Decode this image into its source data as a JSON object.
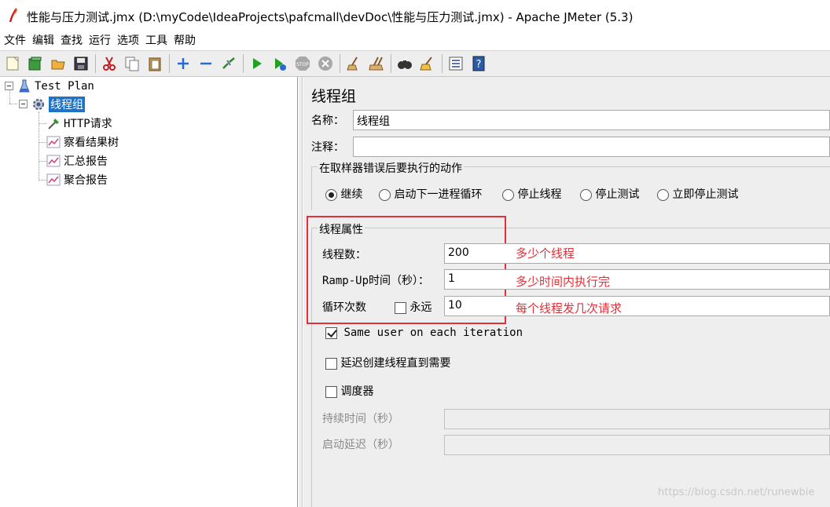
{
  "window": {
    "title": "性能与压力测试.jmx (D:\\myCode\\IdeaProjects\\pafcmall\\devDoc\\性能与压力测试.jmx) - Apache JMeter (5.3)"
  },
  "menu": [
    "文件",
    "编辑",
    "查找",
    "运行",
    "选项",
    "工具",
    "帮助"
  ],
  "toolbar": {
    "icons": [
      "new-icon",
      "templates-icon",
      "open-icon",
      "save-icon",
      "cut-icon",
      "copy-icon",
      "paste-icon",
      "expand-icon",
      "collapse-icon",
      "toggle-icon",
      "start-icon",
      "start-no-pause-icon",
      "stop-icon",
      "shutdown-icon",
      "clear-icon",
      "clear-all-icon",
      "search-icon",
      "reset-search-icon",
      "function-helper-icon",
      "help-icon"
    ]
  },
  "tree": {
    "root": "Test Plan",
    "thread_group": "线程组",
    "children": [
      "HTTP请求",
      "察看结果树",
      "汇总报告",
      "聚合报告"
    ]
  },
  "panel": {
    "heading": "线程组",
    "name_label": "名称：",
    "name_value": "线程组",
    "comment_label": "注释：",
    "comment_value": "",
    "error_action_title": "在取样器错误后要执行的动作",
    "error_actions": [
      "继续",
      "启动下一进程循环",
      "停止线程",
      "停止测试",
      "立即停止测试"
    ],
    "error_action_selected": "继续",
    "thread_props_title": "线程属性",
    "threads_label": "线程数：",
    "threads_value": "200",
    "rampup_label": "Ramp-Up时间（秒）：",
    "rampup_value": "1",
    "loop_label": "循环次数",
    "forever_label": "永远",
    "forever_checked": false,
    "loop_value": "10",
    "same_user_label": "Same user on each iteration",
    "same_user_checked": true,
    "delay_create_label": "延迟创建线程直到需要",
    "delay_create_checked": false,
    "scheduler_label": "调度器",
    "scheduler_checked": false,
    "duration_label": "持续时间（秒）",
    "duration_value": "",
    "startup_delay_label": "启动延迟（秒）",
    "startup_delay_value": ""
  },
  "annotations": {
    "threads_note": "多少个线程",
    "rampup_note": "多少时间内执行完",
    "loop_note": "每个线程发几次请求"
  },
  "watermark": "https://blog.csdn.net/runewbie",
  "colors": {
    "selection": "#1e72c8",
    "annotation_red": "#e0303a",
    "panel_bg": "#eeeeee"
  }
}
